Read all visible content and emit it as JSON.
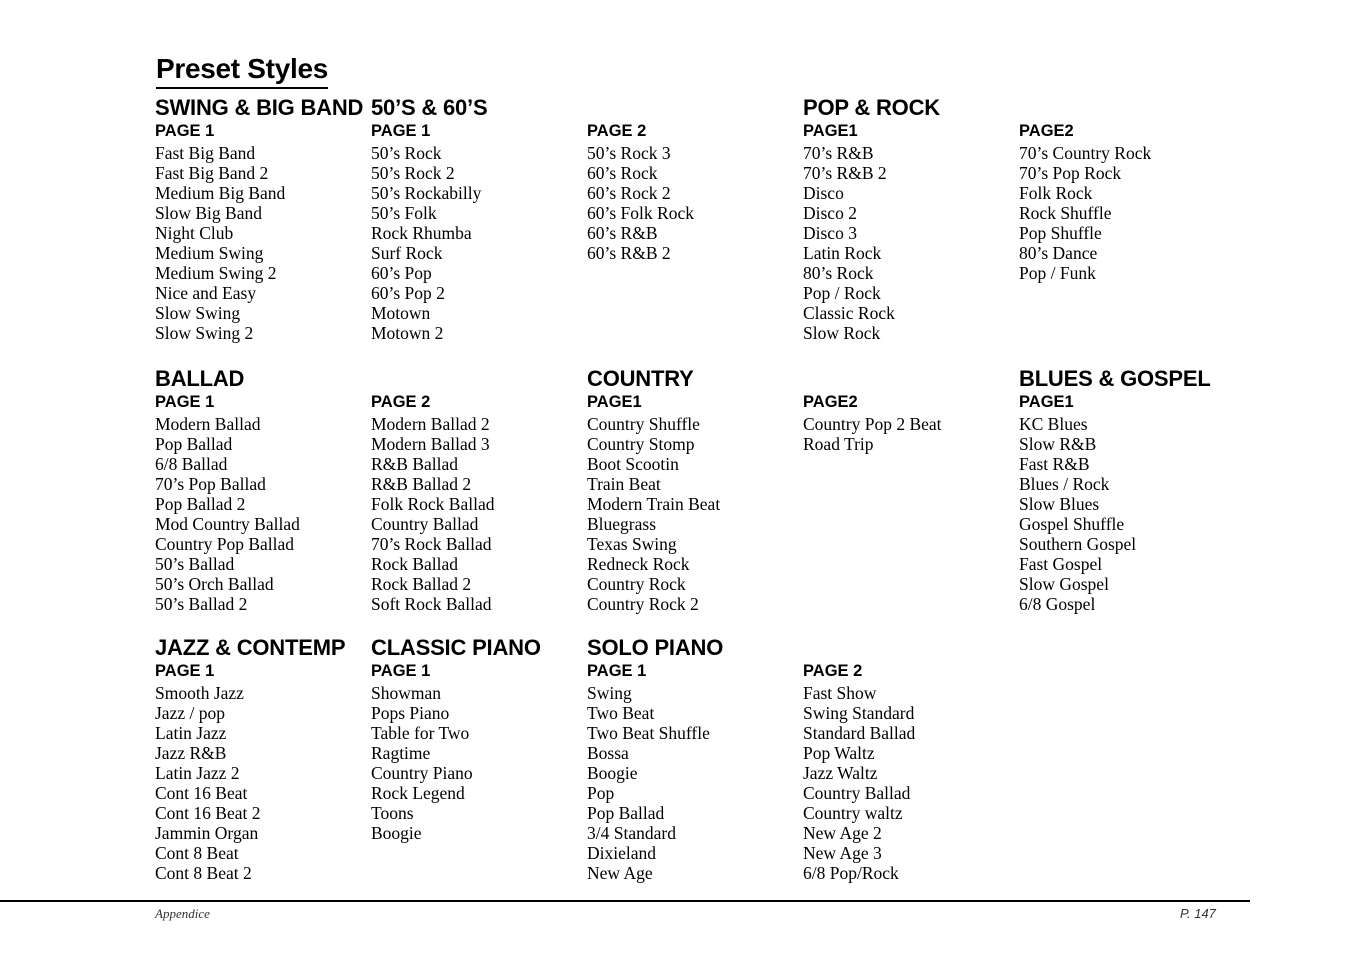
{
  "title": "Preset Styles",
  "sections": {
    "swing": {
      "category": "SWING & BIG BAND",
      "page1": {
        "label": "PAGE 1",
        "items": [
          "Fast Big Band",
          "Fast Big Band 2",
          "Medium Big Band",
          "Slow Big Band",
          "Night Club",
          "Medium Swing",
          "Medium Swing 2",
          "Nice and Easy",
          "Slow Swing",
          "Slow Swing 2"
        ]
      }
    },
    "fifties": {
      "category": "50’S & 60’S",
      "page1": {
        "label": "PAGE 1",
        "items": [
          "50’s Rock",
          "50’s Rock 2",
          "50’s Rockabilly",
          "50’s Folk",
          "Rock Rhumba",
          "Surf Rock",
          "60’s Pop",
          "60’s Pop 2",
          "Motown",
          "Motown 2"
        ]
      },
      "page2": {
        "label": "PAGE 2",
        "items": [
          "50’s Rock 3",
          "60’s Rock",
          "60’s Rock 2",
          "60’s Folk Rock",
          "60’s R&B",
          "60’s R&B 2"
        ]
      }
    },
    "poprock": {
      "category": "POP & ROCK",
      "page1": {
        "label": "PAGE1",
        "items": [
          "70’s R&B",
          "70’s R&B 2",
          "Disco",
          "Disco 2",
          "Disco 3",
          "Latin Rock",
          "80’s Rock",
          "Pop / Rock",
          "Classic Rock",
          "Slow Rock"
        ]
      },
      "page2": {
        "label": "PAGE2",
        "items": [
          "70’s Country Rock",
          "70’s Pop Rock",
          "Folk Rock",
          "Rock Shuffle",
          "Pop Shuffle",
          "80’s Dance",
          "Pop / Funk"
        ]
      }
    },
    "ballad": {
      "category": "BALLAD",
      "page1": {
        "label": "PAGE 1",
        "items": [
          "Modern Ballad",
          "Pop Ballad",
          "6/8 Ballad",
          "70’s Pop Ballad",
          "Pop Ballad 2",
          "Mod Country Ballad",
          "Country Pop Ballad",
          "50’s Ballad",
          "50’s Orch Ballad",
          "50’s Ballad 2"
        ]
      },
      "page2": {
        "label": "PAGE 2",
        "items": [
          "Modern Ballad 2",
          "Modern Ballad 3",
          "R&B Ballad",
          "R&B Ballad 2",
          "Folk Rock Ballad",
          "Country Ballad",
          "70’s Rock Ballad",
          "Rock Ballad",
          "Rock Ballad 2",
          "Soft Rock Ballad"
        ]
      }
    },
    "country": {
      "category": "COUNTRY",
      "page1": {
        "label": "PAGE1",
        "items": [
          "Country Shuffle",
          "Country Stomp",
          "Boot Scootin",
          "Train Beat",
          "Modern Train Beat",
          "Bluegrass",
          "Texas Swing",
          "Redneck Rock",
          "Country Rock",
          "Country Rock 2"
        ]
      },
      "page2": {
        "label": "PAGE2",
        "items": [
          "Country Pop 2 Beat",
          "Road Trip"
        ]
      }
    },
    "blues": {
      "category": "BLUES & GOSPEL",
      "page1": {
        "label": "PAGE1",
        "items": [
          "KC Blues",
          "Slow R&B",
          "Fast R&B",
          "Blues / Rock",
          "Slow Blues",
          "Gospel Shuffle",
          "Southern Gospel",
          "Fast Gospel",
          "Slow Gospel",
          "6/8 Gospel"
        ]
      }
    },
    "jazz": {
      "category": "JAZZ & CONTEMP",
      "page1": {
        "label": "PAGE 1",
        "items": [
          "Smooth Jazz",
          "Jazz / pop",
          "Latin Jazz",
          "Jazz R&B",
          "Latin Jazz 2",
          "Cont 16 Beat",
          "Cont 16 Beat 2",
          "Jammin Organ",
          "Cont 8 Beat",
          "Cont 8 Beat 2"
        ]
      }
    },
    "classic": {
      "category": "CLASSIC PIANO",
      "page1": {
        "label": "PAGE 1",
        "items": [
          "Showman",
          "Pops Piano",
          "Table for Two",
          "Ragtime",
          "Country Piano",
          "Rock Legend",
          "Toons",
          "Boogie"
        ]
      }
    },
    "solo": {
      "category": "SOLO PIANO",
      "page1": {
        "label": "PAGE 1",
        "items": [
          "Swing",
          "Two Beat",
          "Two Beat Shuffle",
          "Bossa",
          "Boogie",
          "Pop",
          "Pop Ballad",
          "3/4 Standard",
          "Dixieland",
          "New Age"
        ]
      },
      "page2": {
        "label": "PAGE 2",
        "items": [
          "Fast Show",
          "Swing Standard",
          "Standard Ballad",
          "Pop Waltz",
          "Jazz Waltz",
          "Country Ballad",
          "Country waltz",
          "New Age 2",
          "New Age 3",
          "6/8 Pop/Rock"
        ]
      }
    }
  },
  "footer": {
    "section": "Appendice",
    "page": "P. 147"
  }
}
